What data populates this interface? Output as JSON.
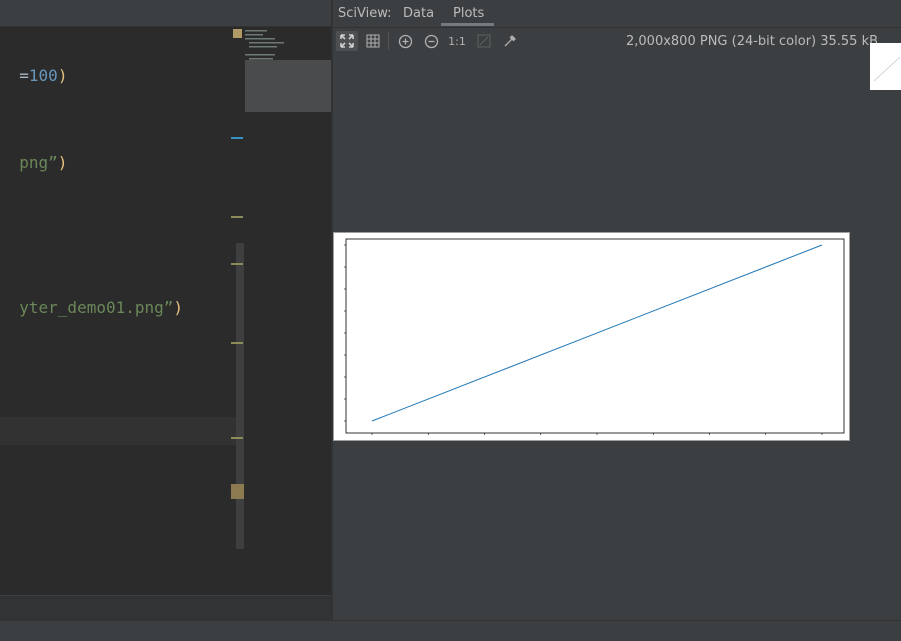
{
  "editor": {
    "lines": [
      {
        "parts": [
          {
            "t": "=",
            "c": "code"
          },
          {
            "t": "100",
            "c": "num"
          },
          {
            "t": ")",
            "c": "paren"
          }
        ]
      },
      {
        "parts": [
          {
            "t": "png”",
            "c": "str"
          },
          {
            "t": ")",
            "c": "paren"
          }
        ]
      },
      {
        "parts": [
          {
            "t": "yter_demo01.png”",
            "c": "str"
          },
          {
            "t": ")",
            "c": "paren"
          }
        ]
      }
    ]
  },
  "sciview": {
    "title": "SciView:",
    "tabs": [
      {
        "label": "Data"
      },
      {
        "label": "Plots"
      }
    ],
    "active_tab": "Plots",
    "zoom_reset_label": "1:1",
    "image_info": "2,000x800 PNG (24-bit color) 35.55 kB",
    "icons": [
      "fit-to-window-icon",
      "grid-icon",
      "zoom-in-icon",
      "zoom-out-icon",
      "actual-size-icon",
      "background-icon",
      "color-picker-icon"
    ]
  },
  "chart_data": {
    "type": "line",
    "x": [
      0,
      1
    ],
    "y": [
      0,
      1
    ],
    "title": "",
    "xlabel": "",
    "ylabel": "",
    "grid": false,
    "color": "#1f77b4"
  }
}
